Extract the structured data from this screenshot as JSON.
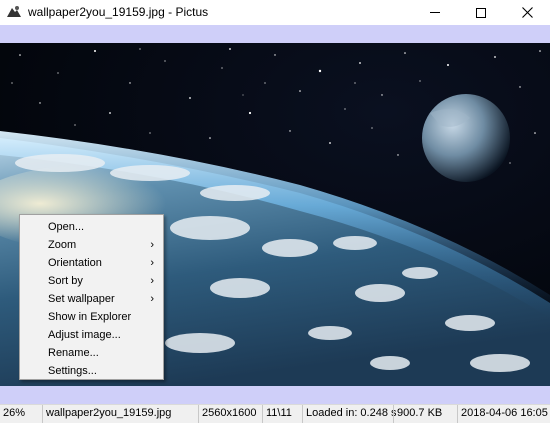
{
  "window": {
    "title": "wallpaper2you_19159.jpg - Pictus",
    "controls": {
      "minimize": "—",
      "maximize": "☐",
      "close": "✕"
    }
  },
  "context_menu": {
    "items": [
      {
        "label": "Open...",
        "submenu": false
      },
      {
        "label": "Zoom",
        "submenu": true
      },
      {
        "label": "Orientation",
        "submenu": true
      },
      {
        "label": "Sort by",
        "submenu": true
      },
      {
        "label": "Set wallpaper",
        "submenu": true
      },
      {
        "label": "Show in Explorer",
        "submenu": false
      },
      {
        "label": "Adjust image...",
        "submenu": false
      },
      {
        "label": "Rename...",
        "submenu": false
      },
      {
        "label": "Settings...",
        "submenu": false
      }
    ],
    "submenu_glyph": "›"
  },
  "status": {
    "zoom": "26%",
    "filename": "wallpaper2you_19159.jpg",
    "resolution": "2560x1600",
    "position": "11\\11",
    "load_time": "Loaded in: 0.248 s",
    "file_size": "900.7 KB",
    "date": "2018-04-06 16:05"
  },
  "colors": {
    "band": "#cfcff9",
    "menu_bg": "#f2f2f2",
    "status_bg": "#f0f0f0"
  },
  "icons": {
    "app": "pictus-app-icon",
    "minimize": "minimize-icon",
    "maximize": "maximize-icon",
    "close": "close-icon",
    "submenu": "chevron-right-icon"
  }
}
